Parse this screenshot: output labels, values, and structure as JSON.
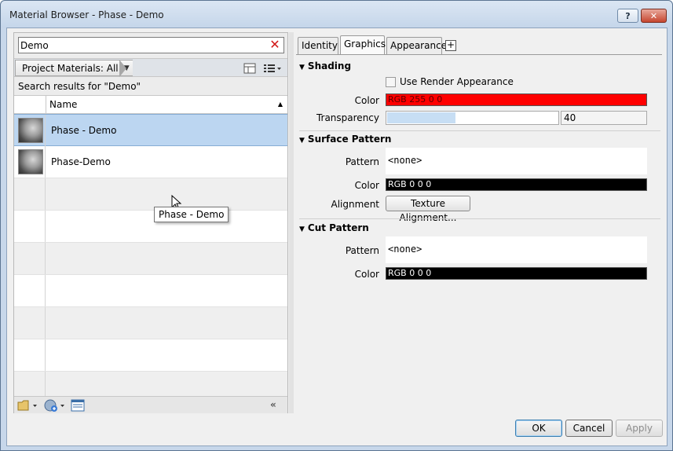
{
  "window": {
    "title": "Material Browser - Phase - Demo"
  },
  "search": {
    "value": "Demo"
  },
  "breadcrumb": {
    "label": "Project Materials: All"
  },
  "results": {
    "label": "Search results for \"Demo\""
  },
  "grid": {
    "column_name": "Name",
    "rows": [
      {
        "name": "Phase - Demo",
        "selected": true
      },
      {
        "name": "Phase-Demo",
        "selected": false
      }
    ],
    "tooltip": "Phase - Demo"
  },
  "tabs": [
    {
      "label": "Identity"
    },
    {
      "label": "Graphics",
      "active": true
    },
    {
      "label": "Appearance"
    }
  ],
  "tab_add": "+",
  "shading": {
    "heading": "Shading",
    "use_render_label": "Use Render Appearance",
    "color_label": "Color",
    "color_value": "RGB 255 0 0",
    "color_hex": "#ff0000",
    "transparency_label": "Transparency",
    "transparency_value": "40"
  },
  "surface_pattern": {
    "heading": "Surface Pattern",
    "pattern_label": "Pattern",
    "pattern_value": "<none>",
    "color_label": "Color",
    "color_value": "RGB 0 0 0",
    "alignment_label": "Alignment",
    "alignment_button": "Texture Alignment..."
  },
  "cut_pattern": {
    "heading": "Cut Pattern",
    "pattern_label": "Pattern",
    "pattern_value": "<none>",
    "color_label": "Color",
    "color_value": "RGB 0 0 0"
  },
  "footer": {
    "ok": "OK",
    "cancel": "Cancel",
    "apply": "Apply"
  },
  "window_buttons": {
    "help": "?",
    "close": "✕"
  },
  "icons": [
    "folder-icon",
    "globe-add-icon",
    "library-panel-icon",
    "collapse-icon",
    "grid-view-icon",
    "list-view-icon"
  ]
}
